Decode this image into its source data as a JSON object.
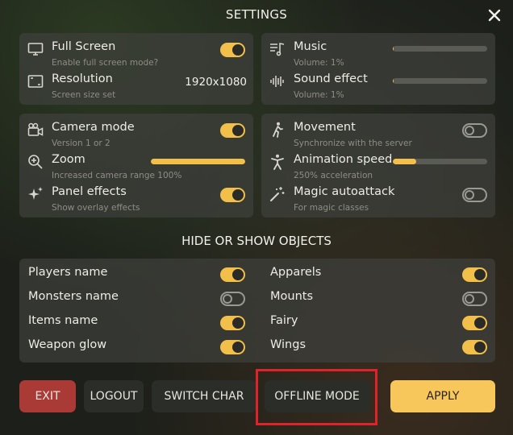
{
  "header": {
    "title": "SETTINGS",
    "close_icon": "close-icon"
  },
  "display": {
    "full_screen": {
      "label": "Full Screen",
      "sub": "Enable full screen mode?",
      "enabled": true,
      "icon": "monitor-icon"
    },
    "resolution": {
      "label": "Resolution",
      "sub": "Screen size set",
      "value": "1920x1080",
      "icon": "resolution-icon"
    }
  },
  "audio": {
    "music": {
      "label": "Music",
      "sub": "Volume: 1%",
      "volume": 0.01,
      "icon": "music-icon"
    },
    "sound_effect": {
      "label": "Sound effect",
      "sub": "Volume: 1%",
      "volume": 0.01,
      "icon": "soundwave-icon"
    }
  },
  "camera": {
    "camera_mode": {
      "label": "Camera mode",
      "sub": "Version 1 or 2",
      "enabled": true,
      "icon": "camera-icon"
    },
    "zoom": {
      "label": "Zoom",
      "sub": "Increased camera range 100%",
      "level": 1.0,
      "icon": "zoom-icon"
    },
    "panel_effects": {
      "label": "Panel effects",
      "sub": "Show overlay effects",
      "enabled": true,
      "icon": "sparkle-icon"
    }
  },
  "gameplay": {
    "movement": {
      "label": "Movement",
      "sub": "Synchronize with the server",
      "enabled": false,
      "icon": "walk-icon"
    },
    "animation_speed": {
      "label": "Animation speed",
      "sub": "250% acceleration",
      "level": 0.25,
      "icon": "figure-icon"
    },
    "magic_autoattack": {
      "label": "Magic autoattack",
      "sub": "For magic classes",
      "enabled": false,
      "icon": "magic-wand-icon"
    }
  },
  "objects": {
    "title": "HIDE OR SHOW OBJECTS",
    "left": [
      {
        "label": "Players name",
        "enabled": true
      },
      {
        "label": "Monsters name",
        "enabled": false
      },
      {
        "label": "Items name",
        "enabled": true
      },
      {
        "label": "Weapon glow",
        "enabled": true
      }
    ],
    "right": [
      {
        "label": "Apparels",
        "enabled": true
      },
      {
        "label": "Mounts",
        "enabled": false
      },
      {
        "label": "Fairy",
        "enabled": true
      },
      {
        "label": "Wings",
        "enabled": true
      }
    ]
  },
  "buttons": {
    "exit": "EXIT",
    "logout": "LOGOUT",
    "switch_char": "SWITCH CHAR",
    "offline_mode": "OFFLINE MODE",
    "apply": "APPLY"
  },
  "colors": {
    "accent": "#f2c04a",
    "exit": "#a93a35",
    "apply": "#f7c75b",
    "highlight": "#e0222a"
  }
}
